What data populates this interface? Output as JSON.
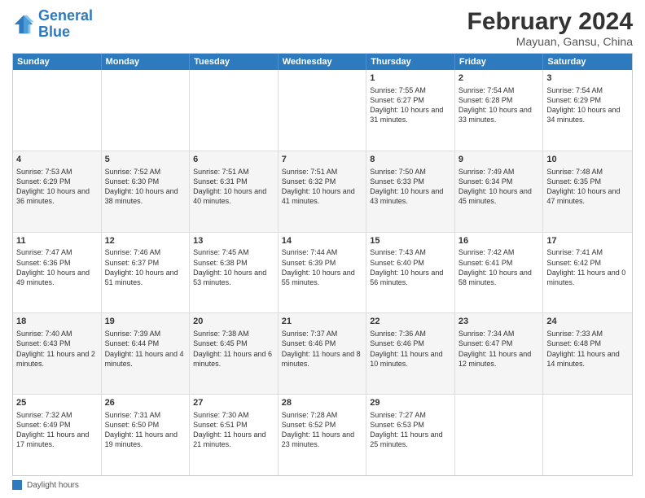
{
  "logo": {
    "line1": "General",
    "line2": "Blue"
  },
  "title": "February 2024",
  "subtitle": "Mayuan, Gansu, China",
  "days": [
    "Sunday",
    "Monday",
    "Tuesday",
    "Wednesday",
    "Thursday",
    "Friday",
    "Saturday"
  ],
  "rows": [
    [
      {
        "day": "",
        "info": ""
      },
      {
        "day": "",
        "info": ""
      },
      {
        "day": "",
        "info": ""
      },
      {
        "day": "",
        "info": ""
      },
      {
        "day": "1",
        "info": "Sunrise: 7:55 AM\nSunset: 6:27 PM\nDaylight: 10 hours and 31 minutes."
      },
      {
        "day": "2",
        "info": "Sunrise: 7:54 AM\nSunset: 6:28 PM\nDaylight: 10 hours and 33 minutes."
      },
      {
        "day": "3",
        "info": "Sunrise: 7:54 AM\nSunset: 6:29 PM\nDaylight: 10 hours and 34 minutes."
      }
    ],
    [
      {
        "day": "4",
        "info": "Sunrise: 7:53 AM\nSunset: 6:29 PM\nDaylight: 10 hours and 36 minutes."
      },
      {
        "day": "5",
        "info": "Sunrise: 7:52 AM\nSunset: 6:30 PM\nDaylight: 10 hours and 38 minutes."
      },
      {
        "day": "6",
        "info": "Sunrise: 7:51 AM\nSunset: 6:31 PM\nDaylight: 10 hours and 40 minutes."
      },
      {
        "day": "7",
        "info": "Sunrise: 7:51 AM\nSunset: 6:32 PM\nDaylight: 10 hours and 41 minutes."
      },
      {
        "day": "8",
        "info": "Sunrise: 7:50 AM\nSunset: 6:33 PM\nDaylight: 10 hours and 43 minutes."
      },
      {
        "day": "9",
        "info": "Sunrise: 7:49 AM\nSunset: 6:34 PM\nDaylight: 10 hours and 45 minutes."
      },
      {
        "day": "10",
        "info": "Sunrise: 7:48 AM\nSunset: 6:35 PM\nDaylight: 10 hours and 47 minutes."
      }
    ],
    [
      {
        "day": "11",
        "info": "Sunrise: 7:47 AM\nSunset: 6:36 PM\nDaylight: 10 hours and 49 minutes."
      },
      {
        "day": "12",
        "info": "Sunrise: 7:46 AM\nSunset: 6:37 PM\nDaylight: 10 hours and 51 minutes."
      },
      {
        "day": "13",
        "info": "Sunrise: 7:45 AM\nSunset: 6:38 PM\nDaylight: 10 hours and 53 minutes."
      },
      {
        "day": "14",
        "info": "Sunrise: 7:44 AM\nSunset: 6:39 PM\nDaylight: 10 hours and 55 minutes."
      },
      {
        "day": "15",
        "info": "Sunrise: 7:43 AM\nSunset: 6:40 PM\nDaylight: 10 hours and 56 minutes."
      },
      {
        "day": "16",
        "info": "Sunrise: 7:42 AM\nSunset: 6:41 PM\nDaylight: 10 hours and 58 minutes."
      },
      {
        "day": "17",
        "info": "Sunrise: 7:41 AM\nSunset: 6:42 PM\nDaylight: 11 hours and 0 minutes."
      }
    ],
    [
      {
        "day": "18",
        "info": "Sunrise: 7:40 AM\nSunset: 6:43 PM\nDaylight: 11 hours and 2 minutes."
      },
      {
        "day": "19",
        "info": "Sunrise: 7:39 AM\nSunset: 6:44 PM\nDaylight: 11 hours and 4 minutes."
      },
      {
        "day": "20",
        "info": "Sunrise: 7:38 AM\nSunset: 6:45 PM\nDaylight: 11 hours and 6 minutes."
      },
      {
        "day": "21",
        "info": "Sunrise: 7:37 AM\nSunset: 6:46 PM\nDaylight: 11 hours and 8 minutes."
      },
      {
        "day": "22",
        "info": "Sunrise: 7:36 AM\nSunset: 6:46 PM\nDaylight: 11 hours and 10 minutes."
      },
      {
        "day": "23",
        "info": "Sunrise: 7:34 AM\nSunset: 6:47 PM\nDaylight: 11 hours and 12 minutes."
      },
      {
        "day": "24",
        "info": "Sunrise: 7:33 AM\nSunset: 6:48 PM\nDaylight: 11 hours and 14 minutes."
      }
    ],
    [
      {
        "day": "25",
        "info": "Sunrise: 7:32 AM\nSunset: 6:49 PM\nDaylight: 11 hours and 17 minutes."
      },
      {
        "day": "26",
        "info": "Sunrise: 7:31 AM\nSunset: 6:50 PM\nDaylight: 11 hours and 19 minutes."
      },
      {
        "day": "27",
        "info": "Sunrise: 7:30 AM\nSunset: 6:51 PM\nDaylight: 11 hours and 21 minutes."
      },
      {
        "day": "28",
        "info": "Sunrise: 7:28 AM\nSunset: 6:52 PM\nDaylight: 11 hours and 23 minutes."
      },
      {
        "day": "29",
        "info": "Sunrise: 7:27 AM\nSunset: 6:53 PM\nDaylight: 11 hours and 25 minutes."
      },
      {
        "day": "",
        "info": ""
      },
      {
        "day": "",
        "info": ""
      }
    ]
  ],
  "legend": {
    "label": "Daylight hours"
  },
  "colors": {
    "header_bg": "#2e7abf",
    "alt_row": "#f5f5f5"
  }
}
